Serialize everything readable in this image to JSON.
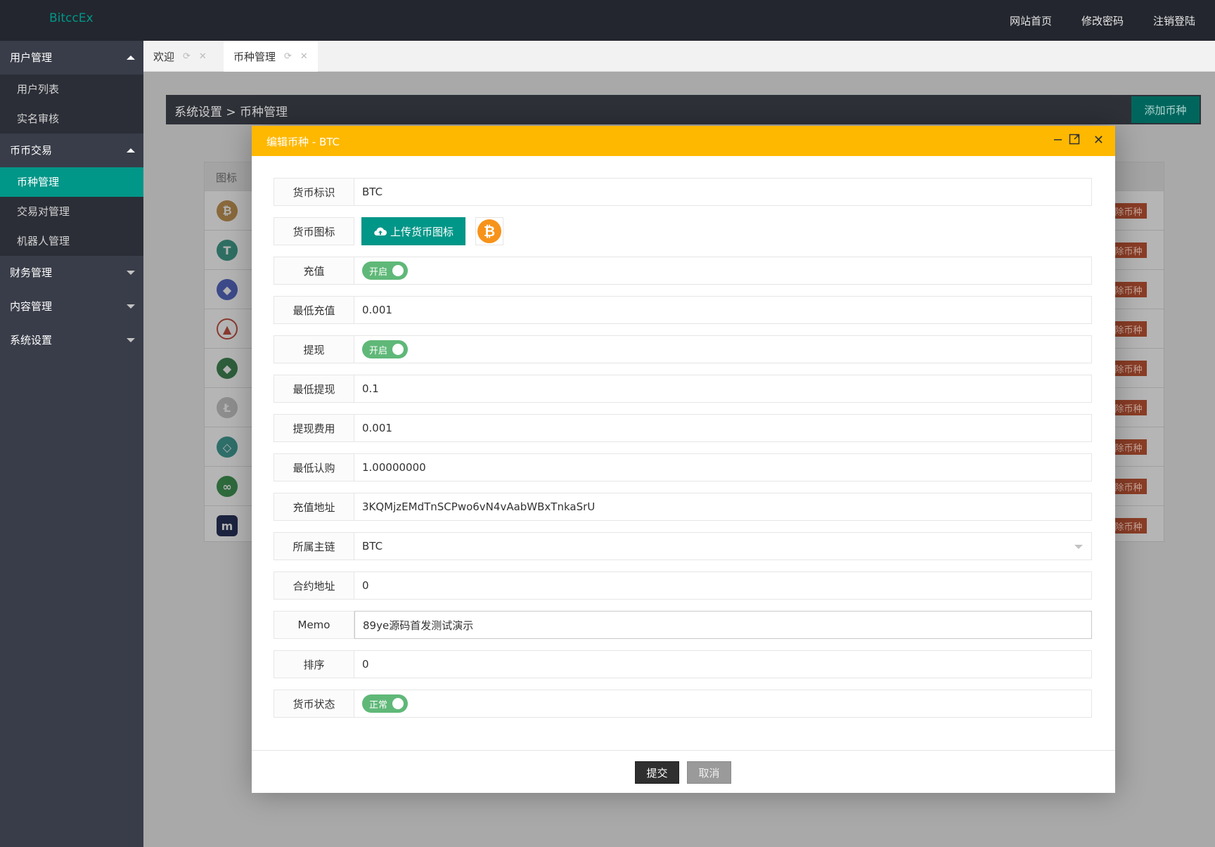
{
  "app": {
    "logo": "BitccEx"
  },
  "topnav": {
    "home": "网站首页",
    "change_password": "修改密码",
    "logout": "注销登陆"
  },
  "sidebar": {
    "groups": [
      {
        "title": "用户管理",
        "open": true,
        "children": [
          "用户列表",
          "实名审核"
        ]
      },
      {
        "title": "币币交易",
        "open": true,
        "children": [
          "币种管理",
          "交易对管理",
          "机器人管理"
        ],
        "active": "币种管理"
      },
      {
        "title": "财务管理",
        "open": false
      },
      {
        "title": "内容管理",
        "open": false
      },
      {
        "title": "系统设置",
        "open": false
      }
    ]
  },
  "tabs": [
    {
      "label": "欢迎"
    },
    {
      "label": "币种管理",
      "active": true
    }
  ],
  "breadcrumb": "系统设置 > 币种管理",
  "add_button": "添加币种",
  "table": {
    "header_icon": "图标",
    "delete_label": "除币种",
    "row_icons": [
      "btc-icon",
      "usdt-icon",
      "eth-icon",
      "red-coin-icon",
      "etc-icon",
      "ltc-icon",
      "shield-coin-icon",
      "link-coin-icon",
      "m-coin-icon"
    ]
  },
  "modal": {
    "title": "编辑币种 - BTC",
    "fields": {
      "symbol": {
        "label": "货币标识",
        "value": "BTC"
      },
      "icon": {
        "label": "货币图标",
        "upload": "上传货币图标"
      },
      "recharge": {
        "label": "充值",
        "switch": "开启"
      },
      "min_recharge": {
        "label": "最低充值",
        "value": "0.001"
      },
      "withdraw": {
        "label": "提现",
        "switch": "开启"
      },
      "min_withdraw": {
        "label": "最低提现",
        "value": "0.1"
      },
      "withdraw_fee": {
        "label": "提现费用",
        "value": "0.001"
      },
      "min_subscribe": {
        "label": "最低认购",
        "value": "1.00000000"
      },
      "recharge_address": {
        "label": "充值地址",
        "value": "3KQMjzEMdTnSCPwo6vN4vAabWBxTnkaSrU"
      },
      "main_chain": {
        "label": "所属主链",
        "value": "BTC"
      },
      "contract_address": {
        "label": "合约地址",
        "value": "0"
      },
      "memo": {
        "label": "Memo",
        "value": "89ye源码首发测试演示"
      },
      "sort": {
        "label": "排序",
        "value": "0"
      },
      "status": {
        "label": "货币状态",
        "switch": "正常"
      }
    },
    "submit": "提交",
    "cancel": "取消"
  },
  "colors": {
    "accent": "#009688",
    "modal_header": "#ffb800",
    "switch_on": "#5fb878",
    "btc": "#f7931a"
  }
}
